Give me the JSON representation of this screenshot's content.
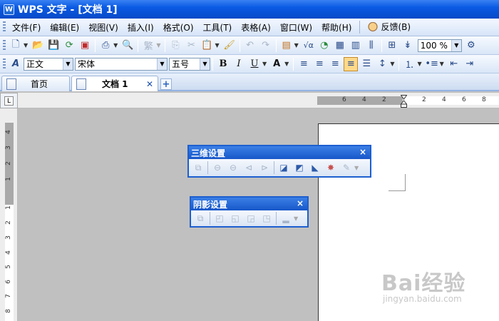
{
  "window": {
    "title": "WPS 文字 - [文档 1]",
    "app_icon_letter": "W"
  },
  "menu": {
    "items": [
      "文件(F)",
      "编辑(E)",
      "视图(V)",
      "插入(I)",
      "格式(O)",
      "工具(T)",
      "表格(A)",
      "窗口(W)",
      "帮助(H)"
    ],
    "feedback": "反馈(B)"
  },
  "toolbar_standard": {
    "zoom_value": "100 %"
  },
  "toolbar_format": {
    "style_value": "正文",
    "font_value": "宋体",
    "size_value": "五号",
    "bold": "B",
    "italic": "I",
    "underline": "U",
    "char": "A"
  },
  "tabs": [
    {
      "label": "首页",
      "active": false
    },
    {
      "label": "文档 1",
      "active": true
    }
  ],
  "ruler": {
    "corner_symbol": "L",
    "h_numbers": [
      "6",
      "4",
      "2",
      "2",
      "4",
      "6",
      "8"
    ],
    "v_numbers": [
      "4",
      "3",
      "2",
      "1",
      "1",
      "2",
      "3",
      "4",
      "5",
      "6",
      "7",
      "8"
    ]
  },
  "float_3d": {
    "title": "三维设置",
    "close": "×"
  },
  "float_shadow": {
    "title": "阴影设置",
    "close": "×"
  },
  "watermark": {
    "main": "Bai经验",
    "sub": "jingyan.baidu.com"
  },
  "colors": {
    "title_bar": "#0a5ae3",
    "workspace": "#c0c0c0",
    "floating_title": "#1d5fd0"
  }
}
